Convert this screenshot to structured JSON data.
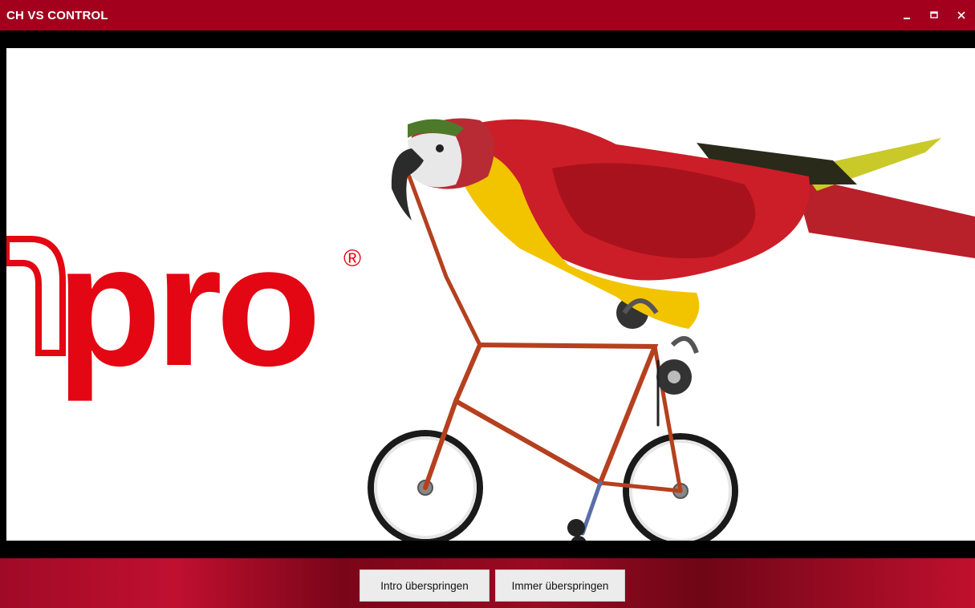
{
  "window": {
    "title": "CH VS CONTROL",
    "controls": [
      "minimize-icon",
      "maximize-icon",
      "close-icon"
    ],
    "accent_color": "#a3001e"
  },
  "video": {
    "logo_text": "pro",
    "logo_mark": "®",
    "logo_color": "#e30613"
  },
  "footer": {
    "skip_intro_label": "Intro überspringen",
    "always_skip_label": "Immer überspringen"
  }
}
